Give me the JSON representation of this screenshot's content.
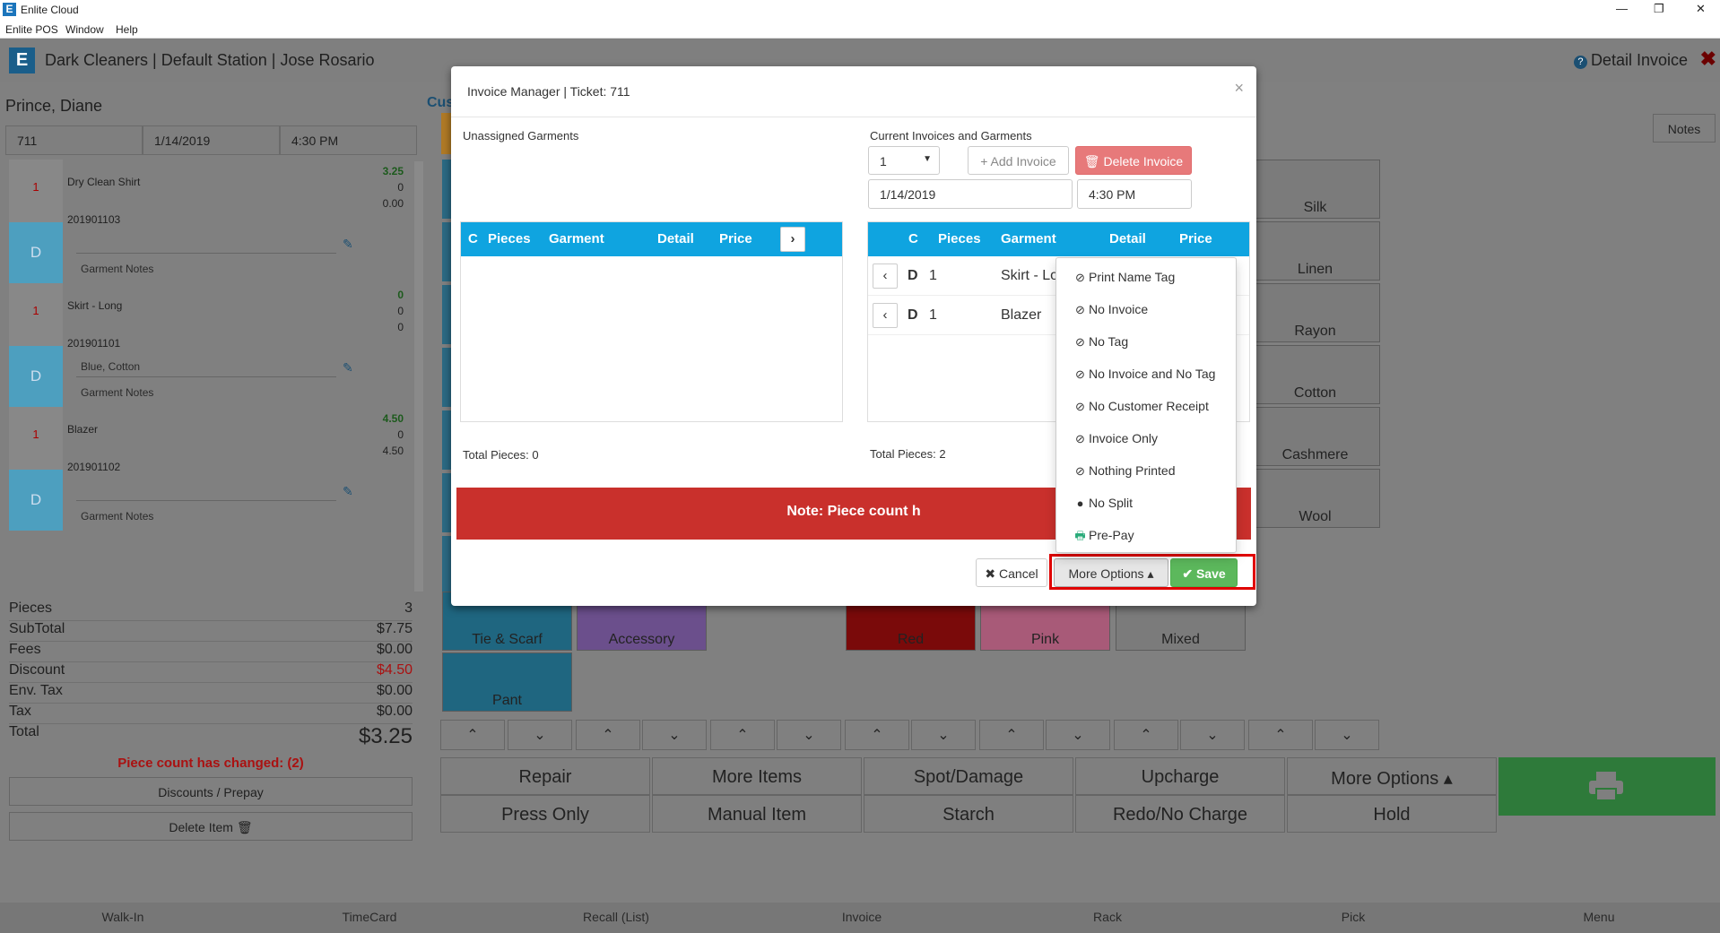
{
  "window": {
    "title": "Enlite Cloud",
    "logo": "E",
    "controls": [
      "—",
      "❐",
      "✕"
    ]
  },
  "menu": [
    "Enlite POS",
    "Window",
    "Help"
  ],
  "header": {
    "logo": "E",
    "title": "Dark Cleaners | Default Station | Jose Rosario",
    "right": "Detail Invoice",
    "help_icon": "?",
    "close": "✖"
  },
  "customer": {
    "name": "Prince, Diane",
    "ticket": "711",
    "date": "1/14/2019",
    "time": "4:30 PM"
  },
  "items": [
    {
      "qty": "1",
      "name": "Dry Clean Shirt",
      "price": "3.25",
      "n2": "0",
      "n3": "0.00",
      "code": "201901103",
      "type": "D",
      "detail": "",
      "notes": "Garment Notes"
    },
    {
      "qty": "1",
      "name": "Skirt - Long",
      "price": "0",
      "n2": "0",
      "n3": "0",
      "code": "201901101",
      "type": "D",
      "detail": "Blue, Cotton",
      "notes": "Garment Notes"
    },
    {
      "qty": "1",
      "name": "Blazer",
      "price": "4.50",
      "n2": "0",
      "n3": "4.50",
      "code": "201901102",
      "type": "D",
      "detail": "",
      "notes": "Garment Notes"
    }
  ],
  "summary": {
    "pieces_label": "Pieces",
    "pieces": "3",
    "subtotal_label": "SubTotal",
    "subtotal": "$7.75",
    "fees_label": "Fees",
    "fees": "$0.00",
    "discount_label": "Discount",
    "discount": "$4.50",
    "envtax_label": "Env. Tax",
    "envtax": "$0.00",
    "tax_label": "Tax",
    "tax": "$0.00",
    "total_label": "Total",
    "total": "$3.25"
  },
  "piece_changed": "Piece count has changed: (2)",
  "left_buttons": {
    "discounts": "Discounts / Prepay",
    "delete_item": "Delete Item 🗑"
  },
  "cu": "Cus",
  "tiles": {
    "materials": [
      "Silk",
      "Linen",
      "Rayon",
      "Cotton",
      "Cashmere",
      "Wool"
    ],
    "row_items": [
      "Tie & Scarf",
      "Accessory",
      "Red",
      "Pink",
      "Mixed",
      "Pant"
    ]
  },
  "arrows": {
    "up": "⌃",
    "down": "⌄"
  },
  "actions": {
    "repair": "Repair",
    "more_items": "More Items",
    "spot": "Spot/Damage",
    "upcharge": "Upcharge",
    "more_options": "More Options ▴",
    "press_only": "Press Only",
    "manual_item": "Manual Item",
    "starch": "Starch",
    "redo": "Redo/No Charge",
    "hold": "Hold"
  },
  "notes_btn": "Notes",
  "bottom_nav": [
    "Walk-In",
    "TimeCard",
    "Recall (List)",
    "Invoice",
    "Rack",
    "Pick",
    "Menu"
  ],
  "modal": {
    "title": "Invoice Manager | Ticket: 711",
    "close": "×",
    "unassigned_label": "Unassigned Garments",
    "current_label": "Current Invoices and Garments",
    "invoice_select": "1",
    "add_invoice": "+ Add Invoice",
    "delete_invoice": "🗑 Delete Invoice",
    "date": "1/14/2019",
    "time": "4:30 PM",
    "cols": {
      "c": "C",
      "pieces": "Pieces",
      "garment": "Garment",
      "detail": "Detail",
      "price": "Price"
    },
    "rows": [
      {
        "c": "D",
        "pieces": "1",
        "garment": "Skirt - Lo"
      },
      {
        "c": "D",
        "pieces": "1",
        "garment": "Blazer"
      }
    ],
    "total_left": "Total Pieces: 0",
    "total_right": "Total Pieces: 2",
    "note": "Note: Piece count h",
    "cancel": "✖ Cancel",
    "more_options": "More Options ▴",
    "save": "✔ Save"
  },
  "dropdown": [
    {
      "icon": "⊘",
      "label": "Print Name Tag"
    },
    {
      "icon": "⊘",
      "label": "No Invoice"
    },
    {
      "icon": "⊘",
      "label": "No Tag"
    },
    {
      "icon": "⊘",
      "label": "No Invoice and No Tag"
    },
    {
      "icon": "⊘",
      "label": "No Customer Receipt"
    },
    {
      "icon": "⊘",
      "label": "Invoice Only"
    },
    {
      "icon": "⊘",
      "label": "Nothing Printed"
    },
    {
      "icon": "●",
      "label": "No Split"
    },
    {
      "icon": "🖶",
      "label": "Pre-Pay"
    }
  ],
  "colors": {
    "accent": "#0fa4e0",
    "danger": "#c9302c",
    "success": "#5cb85c",
    "highlight": "#e00000"
  }
}
